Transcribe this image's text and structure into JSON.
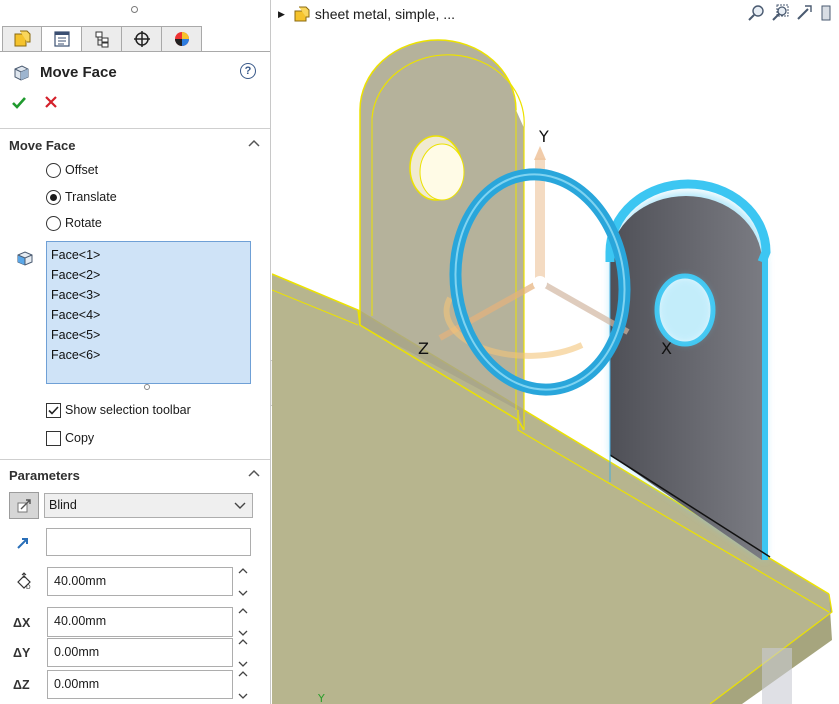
{
  "panel": {
    "title": "Move Face",
    "help_label": "?",
    "tabs": [
      {
        "name": "feature-manager-tab",
        "icon": "feature-tree-icon"
      },
      {
        "name": "property-manager-tab",
        "icon": "property-manager-icon"
      },
      {
        "name": "configuration-manager-tab",
        "icon": "configuration-icon"
      },
      {
        "name": "dimxpert-tab",
        "icon": "crosshair-icon"
      },
      {
        "name": "display-manager-tab",
        "icon": "appearance-icon"
      }
    ],
    "move_face_section": {
      "title": "Move Face",
      "options": [
        "Offset",
        "Translate",
        "Rotate"
      ],
      "selected": "Translate",
      "faces": [
        "Face<1>",
        "Face<2>",
        "Face<3>",
        "Face<4>",
        "Face<5>",
        "Face<6>"
      ],
      "show_selection_toolbar": {
        "label": "Show selection toolbar",
        "checked": true
      },
      "copy": {
        "label": "Copy",
        "checked": false
      }
    },
    "parameters_section": {
      "title": "Parameters",
      "end_condition": "Blind",
      "direction_value": "",
      "distance": "40.00mm",
      "dx_label": "ΔX",
      "dx": "40.00mm",
      "dy_label": "ΔY",
      "dy": "0.00mm",
      "dz_label": "ΔZ",
      "dz": "0.00mm"
    }
  },
  "viewport": {
    "tree_title": "sheet metal, simple, ...",
    "axes": {
      "y": "Y",
      "x": "X",
      "z": "Z",
      "triad_y": "Y"
    }
  },
  "colors": {
    "accent_blue": "#3aa6d8",
    "selection_yellow": "#f2e600",
    "part_tan": "#b4b28a",
    "face_list_bg": "#cfe3f7"
  }
}
